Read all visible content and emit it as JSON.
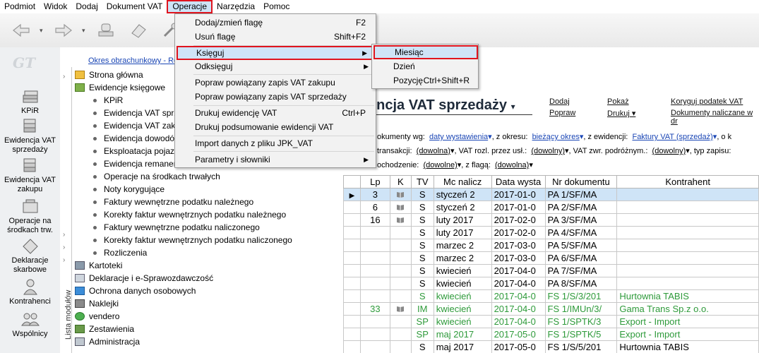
{
  "menubar": [
    "Podmiot",
    "Widok",
    "Dodaj",
    "Dokument VAT",
    "Operacje",
    "Narzędzia",
    "Pomoc"
  ],
  "active_menu": "Operacje",
  "period_link": "Okres obrachunkowy - Ro",
  "logo": "GT",
  "leftnav": [
    {
      "label": "KPiR",
      "icon": "book-stack-icon"
    },
    {
      "label": "Ewidencja VAT sprzedaży",
      "icon": "vat-sales-icon"
    },
    {
      "label": "Ewidencja VAT zakupu",
      "icon": "vat-purchase-icon"
    },
    {
      "label": "Operacje na środkach trw.",
      "icon": "fixed-assets-icon"
    },
    {
      "label": "Deklaracje skarbowe",
      "icon": "declaration-icon"
    },
    {
      "label": "Kontrahenci",
      "icon": "contractor-icon"
    },
    {
      "label": "Wspólnicy",
      "icon": "partners-icon"
    }
  ],
  "module_list_label": "Lista modułów",
  "tree": [
    {
      "label": "Strona główna",
      "level": 0
    },
    {
      "label": "Ewidencje księgowe",
      "level": 0
    },
    {
      "label": "KPiR",
      "level": 1
    },
    {
      "label": "Ewidencja VAT sprze",
      "level": 1
    },
    {
      "label": "Ewidencja VAT zaku",
      "level": 1
    },
    {
      "label": "Ewidencja dowodó",
      "level": 1
    },
    {
      "label": "Eksploatacja pojazd",
      "level": 1
    },
    {
      "label": "Ewidencja remaner",
      "level": 1
    },
    {
      "label": "Operacje na środkach trwałych",
      "level": 1
    },
    {
      "label": "Noty korygujące",
      "level": 1
    },
    {
      "label": "Faktury wewnętrzne podatku należnego",
      "level": 1
    },
    {
      "label": "Korekty faktur wewnętrznych podatku należnego",
      "level": 1
    },
    {
      "label": "Faktury wewnętrzne podatku naliczonego",
      "level": 1
    },
    {
      "label": "Korekty faktur wewnętrznych podatku naliczonego",
      "level": 1
    },
    {
      "label": "Rozliczenia",
      "level": 1
    },
    {
      "label": "Kartoteki",
      "level": 0
    },
    {
      "label": "Deklaracje i e-Sprawozdawczość",
      "level": 0
    },
    {
      "label": "Ochrona danych osobowych",
      "level": 0
    },
    {
      "label": "Naklejki",
      "level": 0
    },
    {
      "label": "vendero",
      "level": 0
    },
    {
      "label": "Zestawienia",
      "level": 0
    },
    {
      "label": "Administracja",
      "level": 0
    }
  ],
  "operacje_menu": [
    {
      "label": "Dodaj/zmień flagę",
      "shortcut": "F2"
    },
    {
      "label": "Usuń flagę",
      "shortcut": "Shift+F2"
    },
    {
      "label": "Księguj",
      "submenu": true,
      "highlight": true
    },
    {
      "label": "Odksięguj",
      "submenu": true
    },
    {
      "label": "Popraw powiązany zapis VAT zakupu"
    },
    {
      "label": "Popraw powiązany zapis VAT sprzedaży"
    },
    {
      "label": "Drukuj ewidencję VAT",
      "shortcut": "Ctrl+P"
    },
    {
      "label": "Drukuj podsumowanie ewidencji VAT"
    },
    {
      "label": "Import danych z pliku JPK_VAT"
    },
    {
      "label": "Parametry i słowniki",
      "submenu": true
    }
  ],
  "ksieguj_submenu": [
    {
      "label": "Miesiąc",
      "highlight": true
    },
    {
      "label": "Dzień"
    },
    {
      "label": "Pozycję",
      "shortcut": "Ctrl+Shift+R"
    }
  ],
  "main": {
    "title": "encja VAT sprzedaży",
    "actions": [
      {
        "label": "Dodaj"
      },
      {
        "label": "Popraw"
      },
      {
        "label": "Pokaż"
      },
      {
        "label": "Drukuj"
      },
      {
        "label": "Koryguj podatek VAT"
      },
      {
        "label": "Dokumenty naliczane w dr"
      }
    ],
    "filter1_prefix": "okumenty wg:",
    "filter1_val": "daty wystawienia",
    "filter1_mid": ", z okresu:",
    "filter1_val2": "bieżący okres",
    "filter1_mid2": ", z ewidencji:",
    "filter1_val3": "Faktury VAT (sprzedaż)",
    "filter1_tail": ", o k",
    "filter2_prefix": "transakcji:",
    "filter2_val": "(dowolna)",
    "filter2_mid": ", VAT rozl. przez usł.:",
    "filter2_val2": "(dowolny)",
    "filter2_mid2": ", VAT zwr. podróżnym.:",
    "filter2_val3": "(dowolny)",
    "filter2_tail": ", typ zapisu:",
    "filter3_prefix": "ochodzenie:",
    "filter3_val": "(dowolne)",
    "filter3_mid": ", z flagą:",
    "filter3_val2": "(dowolna)"
  },
  "table": {
    "headers": [
      "",
      "Lp",
      "K",
      "TV",
      "Mc nalicz",
      "Data wysta",
      "Nr dokumentu",
      "Kontrahent"
    ],
    "rows": [
      {
        "lp": "3",
        "k": true,
        "tv": "S",
        "mc": "styczeń 2",
        "data": "2017-01-0",
        "nr": "PA 1/SF/MA",
        "kontr": "",
        "sel": true
      },
      {
        "lp": "6",
        "k": true,
        "tv": "S",
        "mc": "styczeń 2",
        "data": "2017-01-0",
        "nr": "PA 2/SF/MA",
        "kontr": ""
      },
      {
        "lp": "16",
        "k": true,
        "tv": "S",
        "mc": "luty 2017",
        "data": "2017-02-0",
        "nr": "PA 3/SF/MA",
        "kontr": ""
      },
      {
        "lp": "",
        "k": false,
        "tv": "S",
        "mc": "luty 2017",
        "data": "2017-02-0",
        "nr": "PA 4/SF/MA",
        "kontr": ""
      },
      {
        "lp": "",
        "k": false,
        "tv": "S",
        "mc": "marzec 2",
        "data": "2017-03-0",
        "nr": "PA 5/SF/MA",
        "kontr": ""
      },
      {
        "lp": "",
        "k": false,
        "tv": "S",
        "mc": "marzec 2",
        "data": "2017-03-0",
        "nr": "PA 6/SF/MA",
        "kontr": ""
      },
      {
        "lp": "",
        "k": false,
        "tv": "S",
        "mc": "kwiecień",
        "data": "2017-04-0",
        "nr": "PA 7/SF/MA",
        "kontr": ""
      },
      {
        "lp": "",
        "k": false,
        "tv": "S",
        "mc": "kwiecień",
        "data": "2017-04-0",
        "nr": "PA 8/SF/MA",
        "kontr": ""
      },
      {
        "lp": "",
        "k": false,
        "tv": "S",
        "mc": "kwiecień",
        "data": "2017-04-0",
        "nr": "FS 1/S/3/201",
        "kontr": "Hurtownia TABIS",
        "green": true
      },
      {
        "lp": "33",
        "k": true,
        "tv": "IM",
        "mc": "kwiecień",
        "data": "2017-04-0",
        "nr": "FS 1/IMUn/3/",
        "kontr": "Gama Trans Sp.z o.o.",
        "green": true
      },
      {
        "lp": "",
        "k": false,
        "tv": "SP",
        "mc": "kwiecień",
        "data": "2017-04-0",
        "nr": "FS 1/SPTK/3",
        "kontr": "Export - Import",
        "green": true
      },
      {
        "lp": "",
        "k": false,
        "tv": "SP",
        "mc": "maj 2017",
        "data": "2017-05-0",
        "nr": "FS 1/SPTK/5",
        "kontr": "Export - Import",
        "green": true
      },
      {
        "lp": "",
        "k": false,
        "tv": "S",
        "mc": "maj 2017",
        "data": "2017-05-0",
        "nr": "FS 1/S/5/201",
        "kontr": "Hurtownia TABIS"
      }
    ]
  }
}
